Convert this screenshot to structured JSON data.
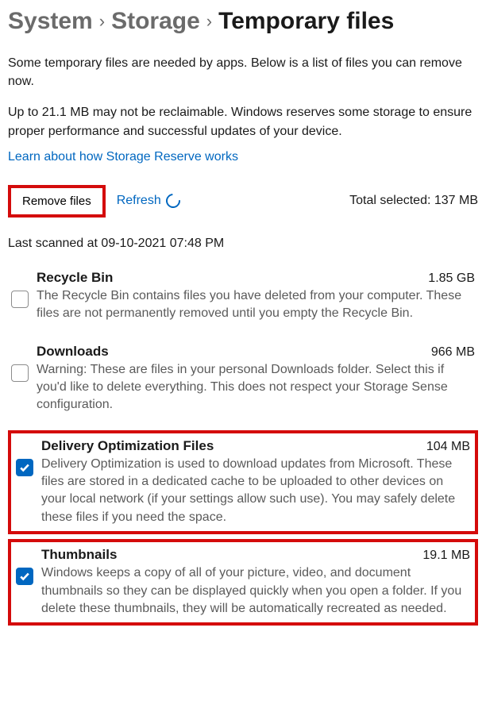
{
  "breadcrumb": {
    "items": [
      {
        "label": "System"
      },
      {
        "label": "Storage"
      },
      {
        "label": "Temporary files"
      }
    ]
  },
  "intro": "Some temporary files are needed by apps. Below is a list of files you can remove now.",
  "reserve_note": "Up to 21.1 MB may not be reclaimable. Windows reserves some storage to ensure proper performance and successful updates of your device.",
  "reserve_link": "Learn about how Storage Reserve works",
  "actions": {
    "remove": "Remove files",
    "refresh": "Refresh",
    "total_label": "Total selected: ",
    "total_value": "137 MB"
  },
  "last_scanned": "Last scanned at 09-10-2021 07:48 PM",
  "items": [
    {
      "title": "Recycle Bin",
      "size": "1.85 GB",
      "desc": "The Recycle Bin contains files you have deleted from your computer. These files are not permanently removed until you empty the Recycle Bin.",
      "checked": false,
      "highlight": false
    },
    {
      "title": "Downloads",
      "size": "966 MB",
      "desc": "Warning: These are files in your personal Downloads folder. Select this if you'd like to delete everything. This does not respect your Storage Sense configuration.",
      "checked": false,
      "highlight": false
    },
    {
      "title": "Delivery Optimization Files",
      "size": "104 MB",
      "desc": "Delivery Optimization is used to download updates from Microsoft. These files are stored in a dedicated cache to be uploaded to other devices on your local network (if your settings allow such use). You may safely delete these files if you need the space.",
      "checked": true,
      "highlight": true
    },
    {
      "title": "Thumbnails",
      "size": "19.1 MB",
      "desc": "Windows keeps a copy of all of your picture, video, and document thumbnails so they can be displayed quickly when you open a folder. If you delete these thumbnails, they will be automatically recreated as needed.",
      "checked": true,
      "highlight": true
    }
  ]
}
